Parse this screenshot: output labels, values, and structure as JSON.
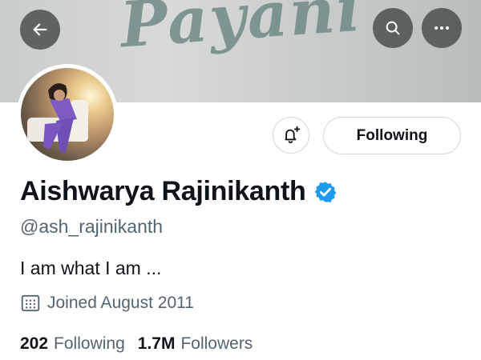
{
  "banner": {
    "text": "Payani"
  },
  "header": {
    "back_icon": "arrow-left-icon",
    "search_icon": "search-icon",
    "more_icon": "more-horizontal-icon"
  },
  "actions": {
    "notify_icon": "bell-plus-icon",
    "following_label": "Following"
  },
  "profile": {
    "name": "Aishwarya Rajinikanth",
    "verified_icon": "verified-badge-icon",
    "handle": "@ash_rajinikanth",
    "bio": "I am what I am ...",
    "joined": "Joined August 2011",
    "following_count": "202",
    "following_label": "Following",
    "followers_count": "1.7M",
    "followers_label": "Followers"
  },
  "colors": {
    "verified": "#1d9bf0",
    "secondary_text": "#536471",
    "primary_text": "#0f1419",
    "border": "#cfd9de"
  }
}
